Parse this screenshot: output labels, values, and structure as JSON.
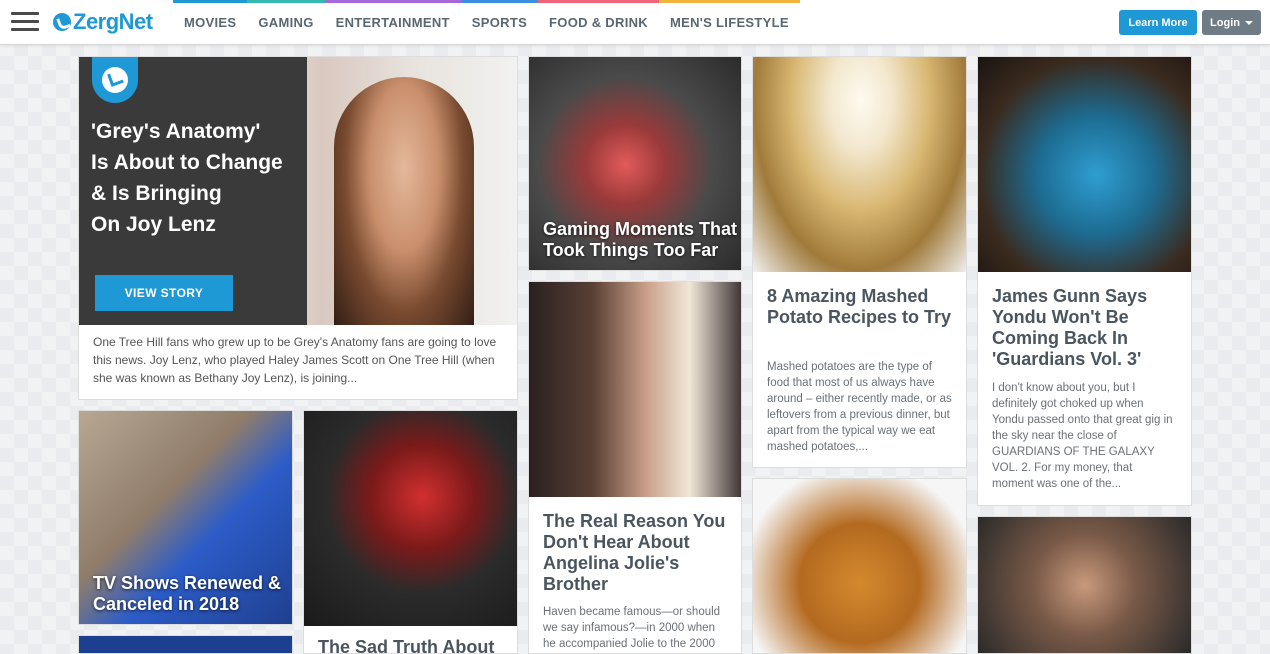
{
  "header": {
    "logo_text": "ZergNet",
    "nav": [
      {
        "label": "MOVIES",
        "color": "#1f98d6"
      },
      {
        "label": "GAMING",
        "color": "#36b7b2"
      },
      {
        "label": "ENTERTAINMENT",
        "color": "#a668d8"
      },
      {
        "label": "SPORTS",
        "color": "#3a8fe0"
      },
      {
        "label": "FOOD & DRINK",
        "color": "#f0647a"
      },
      {
        "label": "MEN'S LIFESTYLE",
        "color": "#f2b43c"
      }
    ],
    "learn_more": "Learn More",
    "login": "Login"
  },
  "hero": {
    "title_lines": [
      "'Grey's Anatomy'",
      "Is About to Change",
      "& Is Bringing",
      "On Joy Lenz"
    ],
    "button": "VIEW STORY",
    "desc": "One Tree Hill fans who grew up to be Grey's Anatomy fans are going to love this news. Joy Lenz, who played Haley James Scott on One Tree Hill (when she was known as Bethany Joy Lenz), is joining..."
  },
  "cards": {
    "gaming": {
      "title": "Gaming Moments That Took Things Too Far"
    },
    "potato": {
      "title": "8 Amazing Mashed Potato Recipes to Try",
      "desc": "Mashed potatoes are the type of food that most of us always have around – either recently made, or as leftovers from a previous dinner, but apart from the typical way we eat mashed potatoes,..."
    },
    "yondu": {
      "title": "James Gunn Says Yondu Won't Be Coming Back In 'Guardians Vol. 3'",
      "desc": "I don't know about you, but I definitely got choked up when Yondu passed onto that great gig in the sky near the close of GUARDIANS OF THE GALAXY VOL. 2. For my money, that moment was one of the..."
    },
    "angelina": {
      "title": "The Real Reason You Don't Hear About Angelina Jolie's Brother",
      "desc": "Haven became famous—or should we say infamous?—in 2000 when he accompanied Jolie to the 2000"
    },
    "tv": {
      "title": "TV Shows Renewed & Canceled in 2018"
    },
    "switch": {
      "title": "The Sad Truth About"
    }
  }
}
